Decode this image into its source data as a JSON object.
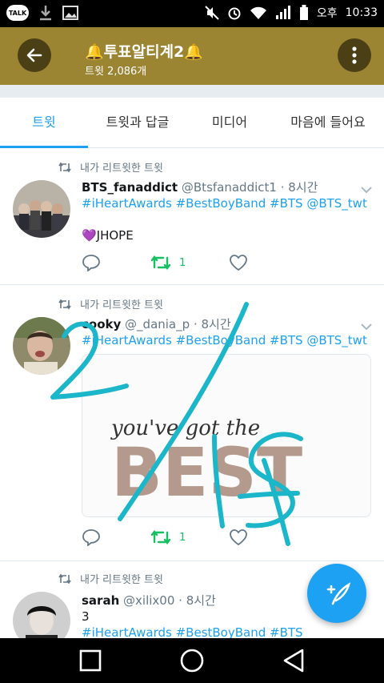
{
  "status_bar": {
    "talk_icon": "talk-icon",
    "period": "오후",
    "time": "10:33"
  },
  "app_bar": {
    "title": "🔔투표알티계2🔔",
    "subtitle": "트윗 2,086개"
  },
  "tabs": [
    {
      "label": "트윗",
      "active": true
    },
    {
      "label": "트윗과 답글",
      "active": false
    },
    {
      "label": "미디어",
      "active": false
    },
    {
      "label": "마음에 들어요",
      "active": false
    }
  ],
  "tweets": [
    {
      "retweet_context": "내가 리트윗한 트윗",
      "name": "BTS_fanaddict",
      "handle": "@Btsfanaddict1",
      "time": "· 8시간",
      "hashtags": "#iHeartAwards #BestBoyBand #BTS @BTS_twt",
      "text": "💜JHOPE",
      "retweet_count": "1"
    },
    {
      "retweet_context": "내가 리트윗한 트윗",
      "name": "cooky",
      "handle": "@_dania_p",
      "time": "· 8시간",
      "hashtags": "#iHeartAwards #BestBoyBand #BTS @BTS_twt",
      "media_caption": "you've got the",
      "media_word": "BEST",
      "retweet_count": "1"
    },
    {
      "retweet_context": "내가 리트윗한 트윗",
      "name": "sarah",
      "handle": "@xilix00",
      "time": "· 8시간",
      "text": "3",
      "hashtags": "#iHeartAwards #BestBoyBand #BTS"
    }
  ],
  "colors": {
    "app_bar": "#9b8532",
    "accent": "#1da1f2",
    "retweet_green": "#17bf63",
    "scribble": "#1bb6c9"
  }
}
